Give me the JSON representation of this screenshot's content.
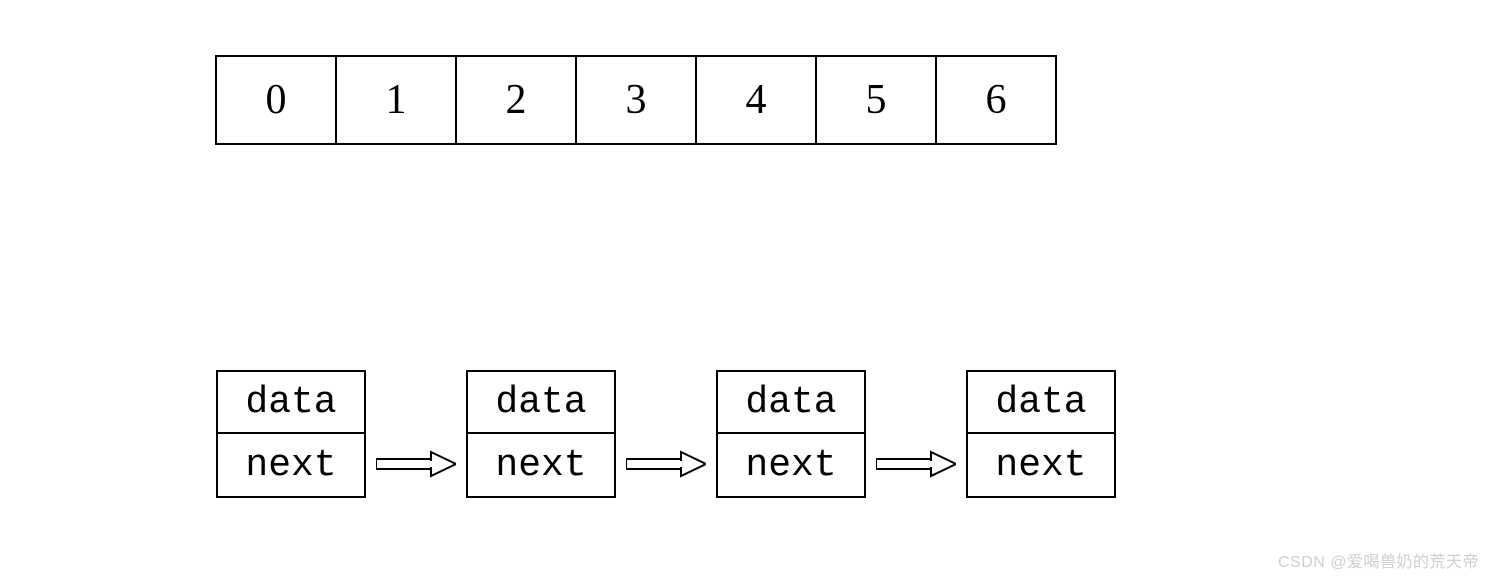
{
  "array": {
    "cells": [
      "0",
      "1",
      "2",
      "3",
      "4",
      "5",
      "6"
    ]
  },
  "linked_list": {
    "node_count": 4,
    "labels": {
      "top": "data",
      "bottom": "next"
    }
  },
  "watermark": "CSDN @爱喝兽奶的荒天帝"
}
